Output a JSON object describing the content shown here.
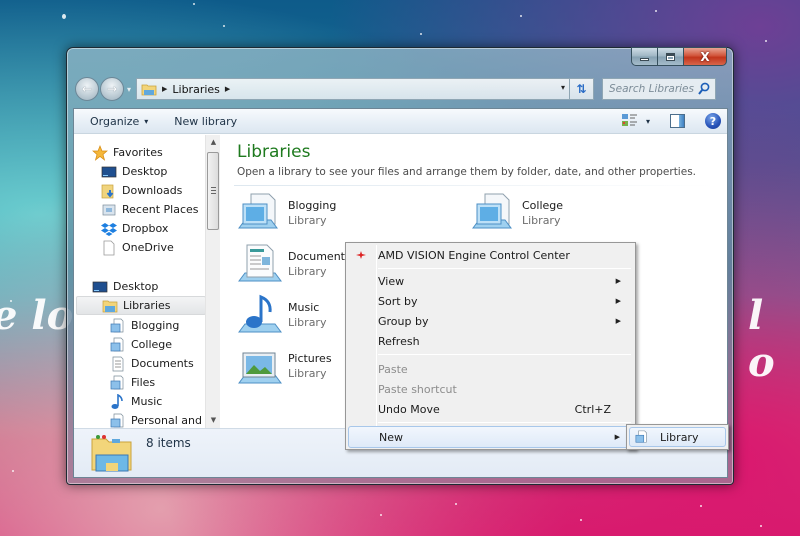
{
  "desktop": {
    "wallpaper_text_left": "e lo",
    "wallpaper_text_right": "l o"
  },
  "window": {
    "caption_buttons": {
      "minimize_icon": "minimize-icon",
      "maximize_icon": "maximize-icon",
      "close_icon": "close-icon",
      "close_glyph": "X"
    },
    "nav": {
      "back_glyph": "←",
      "forward_glyph": "→",
      "recent_glyph": "▾",
      "address": {
        "icon": "libraries-folder-icon",
        "sep_glyph": "▶",
        "crumbs": [
          "Libraries"
        ],
        "dropdown_glyph": "▾"
      },
      "refresh_glyph": "⇅",
      "search": {
        "placeholder": "Search Libraries",
        "value": ""
      }
    },
    "toolbar": {
      "organize_label": "Organize",
      "caret": "▾",
      "new_library_label": "New library",
      "views_caret": "▾",
      "help_glyph": "?"
    },
    "sidebar": {
      "favorites": {
        "label": "Favorites",
        "items": [
          {
            "label": "Desktop",
            "icon": "desktop-icon"
          },
          {
            "label": "Downloads",
            "icon": "downloads-icon"
          },
          {
            "label": "Recent Places",
            "icon": "recent-places-icon"
          },
          {
            "label": "Dropbox",
            "icon": "dropbox-icon"
          },
          {
            "label": "OneDrive",
            "icon": "onedrive-icon"
          }
        ]
      },
      "desktop_label": "Desktop",
      "libraries_label": "Libraries",
      "libraries_selected": true,
      "libraries_items": [
        {
          "label": "Blogging",
          "icon": "library-icon"
        },
        {
          "label": "College",
          "icon": "library-icon"
        },
        {
          "label": "Documents",
          "icon": "documents-icon"
        },
        {
          "label": "Files",
          "icon": "library-icon"
        },
        {
          "label": "Music",
          "icon": "music-icon"
        },
        {
          "label": "Personal and D",
          "icon": "library-icon"
        }
      ],
      "scroll_up_glyph": "▲",
      "scroll_down_glyph": "▼"
    },
    "content": {
      "title": "Libraries",
      "description": "Open a library to see your files and arrange them by folder, date, and other properties.",
      "libraries": [
        {
          "name": "Blogging",
          "type": "Library",
          "icon": "generic"
        },
        {
          "name": "College",
          "type": "Library",
          "icon": "generic"
        },
        {
          "name": "Documents",
          "type": "Library",
          "icon": "documents"
        },
        {
          "name": "Music",
          "type": "Library",
          "icon": "music"
        },
        {
          "name": "Pictures",
          "type": "Library",
          "icon": "pictures"
        }
      ]
    },
    "status": {
      "text": "8 items"
    }
  },
  "context_menu": {
    "items": [
      {
        "label": "AMD VISION Engine Control Center",
        "icon": "amd-icon"
      },
      {
        "label": "View",
        "submenu": true
      },
      {
        "label": "Sort by",
        "submenu": true
      },
      {
        "label": "Group by",
        "submenu": true
      },
      {
        "label": "Refresh"
      },
      {
        "label": "Paste",
        "disabled": true
      },
      {
        "label": "Paste shortcut",
        "disabled": true
      },
      {
        "label": "Undo Move",
        "shortcut": "Ctrl+Z"
      },
      {
        "label": "New",
        "submenu": true,
        "highlighted": true
      }
    ],
    "arrow_glyph": "▶",
    "submenu_new": {
      "items": [
        {
          "label": "Library",
          "icon": "library-icon",
          "highlighted": true
        }
      ]
    }
  }
}
